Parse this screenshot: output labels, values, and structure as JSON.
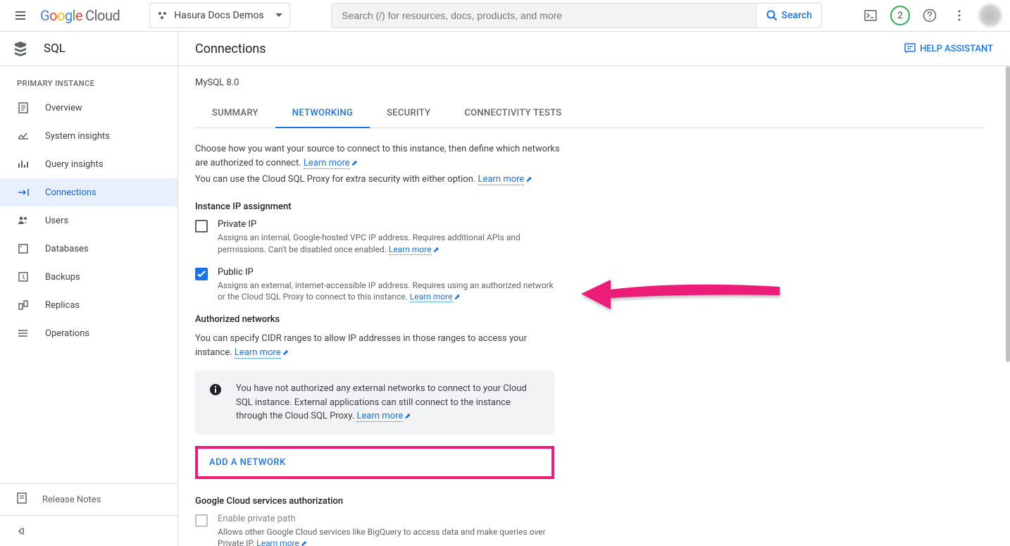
{
  "header": {
    "logo_cloud": "Cloud",
    "project_name": "Hasura Docs Demos",
    "search_placeholder": "Search (/) for resources, docs, products, and more",
    "search_button": "Search",
    "notification_count": "2"
  },
  "sidebar": {
    "product": "SQL",
    "section_label": "PRIMARY INSTANCE",
    "items": [
      {
        "label": "Overview"
      },
      {
        "label": "System insights"
      },
      {
        "label": "Query insights"
      },
      {
        "label": "Connections"
      },
      {
        "label": "Users"
      },
      {
        "label": "Databases"
      },
      {
        "label": "Backups"
      },
      {
        "label": "Replicas"
      },
      {
        "label": "Operations"
      }
    ],
    "release_notes": "Release Notes"
  },
  "page": {
    "title": "Connections",
    "help_assistant": "HELP ASSISTANT",
    "subtitle": "MySQL 8.0",
    "tabs": [
      {
        "label": "SUMMARY"
      },
      {
        "label": "NETWORKING"
      },
      {
        "label": "SECURITY"
      },
      {
        "label": "CONNECTIVITY TESTS"
      }
    ],
    "intro1": "Choose how you want your source to connect to this instance, then define which networks are authorized to connect. ",
    "intro2": "You can use the Cloud SQL Proxy for extra security with either option. ",
    "learn_more": "Learn more",
    "ip_section_title": "Instance IP assignment",
    "private_ip": {
      "label": "Private IP",
      "desc": "Assigns an internal, Google-hosted VPC IP address. Requires additional APIs and permissions. Can't be disabled once enabled. "
    },
    "public_ip": {
      "label": "Public IP",
      "desc": "Assigns an external, internet-accessible IP address. Requires using an authorized network or the Cloud SQL Proxy to connect to this instance. "
    },
    "authorized_title": "Authorized networks",
    "authorized_desc": "You can specify CIDR ranges to allow IP addresses in those ranges to access your instance. ",
    "info_box": "You have not authorized any external networks to connect to your Cloud SQL instance. External applications can still connect to the instance through the Cloud SQL Proxy. ",
    "add_network": "ADD A NETWORK",
    "gcs_title": "Google Cloud services authorization",
    "private_path": {
      "label": "Enable private path",
      "desc": "Allows other Google Cloud services like BigQuery to access data and make queries over Private IP. "
    }
  }
}
